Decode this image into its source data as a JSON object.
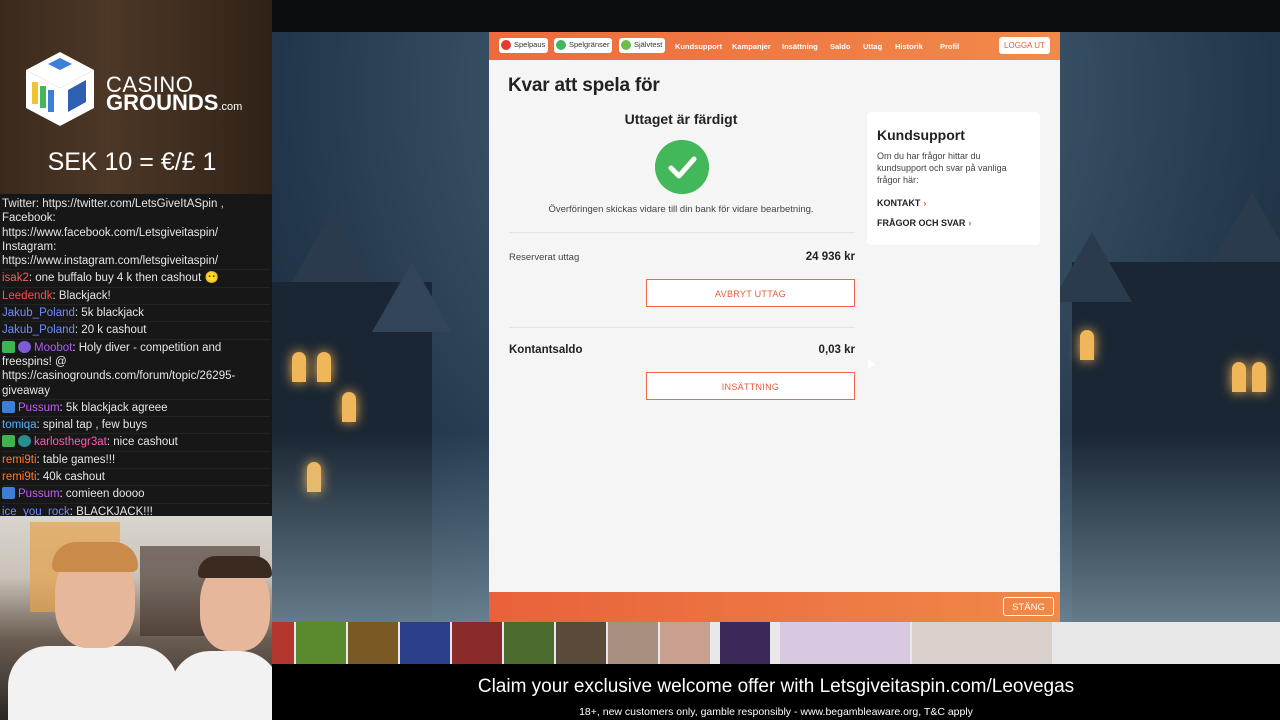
{
  "overlay": {
    "brand_line1": "CASINO",
    "brand_line2": "GROUNDS",
    "brand_tld": ".com",
    "rate": "SEK 10 = €/£ 1"
  },
  "chat": [
    {
      "user": "",
      "text": "Twitter: https://twitter.com/LetsGiveItASpin , Facebook: https://www.facebook.com/Letsgiveitaspin/ Instagram: https://www.instagram.com/letsgiveitaspin/",
      "color": "#e6e6e6",
      "badges": []
    },
    {
      "user": "isak2",
      "text": ": one buffalo buy 4 k then cashout 😶",
      "color": "#ff5a5a",
      "badges": []
    },
    {
      "user": "Leedendk",
      "text": ": Blackjack!",
      "color": "#ff4a4a",
      "badges": []
    },
    {
      "user": "Jakub_Poland",
      "text": ": 5k blackjack",
      "color": "#6f8cff",
      "badges": []
    },
    {
      "user": "Jakub_Poland",
      "text": ": 20 k cashout",
      "color": "#6f8cff",
      "badges": []
    },
    {
      "user": "Moobot",
      "text": ": Holy diver - competition and freespins! @ https://casinogrounds.com/forum/topic/26295-giveaway",
      "color": "#b05cf5",
      "badges": [
        "green",
        "purple"
      ]
    },
    {
      "user": "Pussum",
      "text": ": 5k blackjack agreee",
      "color": "#c35cff",
      "badges": [
        "blue"
      ]
    },
    {
      "user": "tomiqa",
      "text": ": spinal tap , few buys",
      "color": "#53b4ff",
      "badges": []
    },
    {
      "user": "karlosthegr3at",
      "text": ": nice cashout",
      "color": "#ff5ab4",
      "badges": [
        "green",
        "teal"
      ]
    },
    {
      "user": "remi9ti",
      "text": ": table games!!!",
      "color": "#ff7a2a",
      "badges": []
    },
    {
      "user": "remi9ti",
      "text": ": 40k cashout",
      "color": "#ff7a2a",
      "badges": []
    },
    {
      "user": "Pussum",
      "text": ": comieen doooo",
      "color": "#c35cff",
      "badges": [
        "blue"
      ]
    },
    {
      "user": "ice_you_rock",
      "text": ": BLACKJACK!!!",
      "color": "#6f8cff",
      "badges": []
    }
  ],
  "nav": {
    "pills": [
      "Spelpaus",
      "Spelgränser",
      "Självtest"
    ],
    "links": [
      "Kundsupport",
      "Kampanjer",
      "Insättning",
      "Saldo",
      "Uttag",
      "Historik",
      "Profil"
    ],
    "logout": "LOGGA UT"
  },
  "modal": {
    "title": "Kvar att spela för",
    "done_title": "Uttaget är färdigt",
    "done_text": "Överföringen skickas vidare till din bank för vidare bearbetning.",
    "reserved_label": "Reserverat uttag",
    "reserved_value": "24 936 kr",
    "cancel_button": "AVBRYT UTTAG",
    "cash_label": "Kontantsaldo",
    "cash_value": "0,03 kr",
    "deposit_button": "INSÄTTNING",
    "close_button": "STÄNG"
  },
  "support": {
    "title": "Kundsupport",
    "text": "Om du har frågor hittar du kundsupport och svar på vanliga frågor här:",
    "link1": "KONTAKT",
    "link2": "FRÅGOR OCH SVAR"
  },
  "banner": {
    "main": "Claim your exclusive welcome offer with Letsgiveitaspin.com/Leovegas",
    "sub": "18+, new customers only, gamble responsibly - www.begambleaware.org, T&C apply"
  },
  "colors": {
    "accent": "#ee6a3e",
    "success": "#43b85a"
  }
}
